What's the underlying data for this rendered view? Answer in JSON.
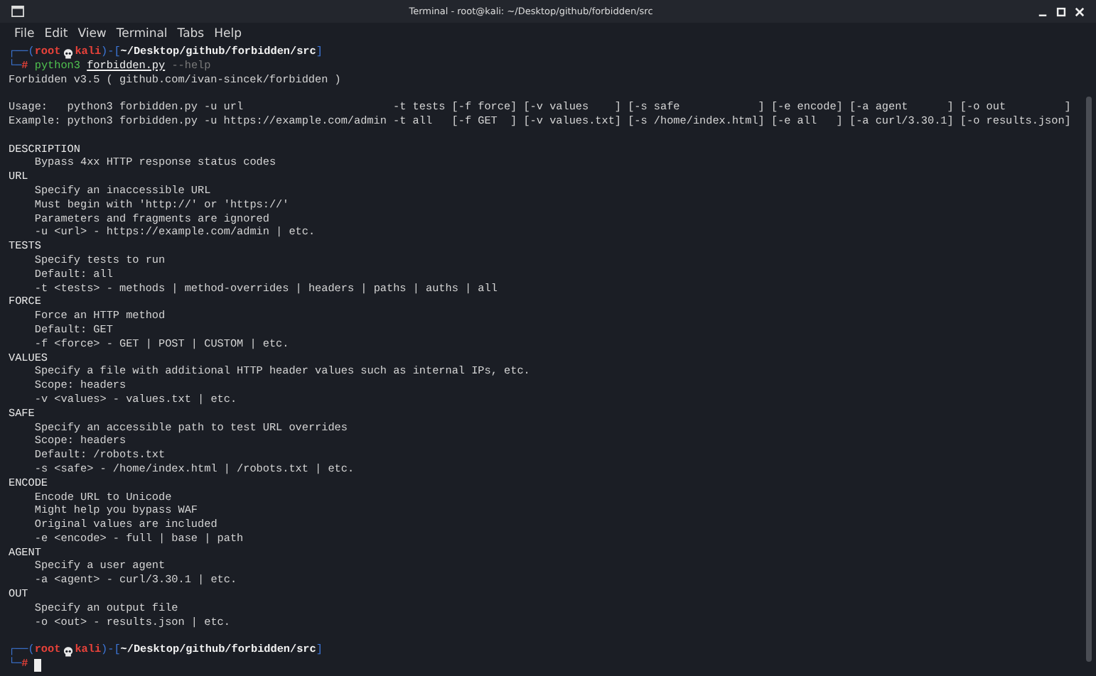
{
  "window": {
    "title": "Terminal - root@kali: ~/Desktop/github/forbidden/src"
  },
  "menu": [
    "File",
    "Edit",
    "View",
    "Terminal",
    "Tabs",
    "Help"
  ],
  "header": [
    {
      "kind": "prompt",
      "open": "┌──(",
      "user": "root",
      "host": "kali",
      "mid": ")-[",
      "path": "~/Desktop/github/forbidden/src",
      "close": "]"
    },
    {
      "kind": "command",
      "lead": "└─",
      "sign": "#",
      "program": "python3",
      "script": "forbidden.py",
      "args": "--help"
    },
    {
      "kind": "output",
      "text": "Forbidden v3.5 ( github.com/ivan-sincek/forbidden )"
    },
    {
      "kind": "output",
      "blank_before": true,
      "text": "Usage:   python3 forbidden.py -u url                       -t tests [-f force] [-v values    ] [-s safe            ] [-e encode] [-a agent      ] [-o out         ]"
    },
    {
      "kind": "output",
      "text": "Example: python3 forbidden.py -u https://example.com/admin -t all   [-f GET  ] [-v values.txt] [-s /home/index.html] [-e all   ] [-a curl/3.30.1] [-o results.json]"
    }
  ],
  "sections": [
    {
      "heading": "DESCRIPTION",
      "blank_before": true,
      "lines": [
        "Bypass 4xx HTTP response status codes"
      ]
    },
    {
      "heading": "URL",
      "lines": [
        "Specify an inaccessible URL",
        "Must begin with 'http://' or 'https://'",
        "Parameters and fragments are ignored",
        "-u <url> - https://example.com/admin | etc."
      ]
    },
    {
      "heading": "TESTS",
      "lines": [
        "Specify tests to run",
        "Default: all",
        "-t <tests> - methods | method-overrides | headers | paths | auths | all"
      ]
    },
    {
      "heading": "FORCE",
      "lines": [
        "Force an HTTP method",
        "Default: GET",
        "-f <force> - GET | POST | CUSTOM | etc."
      ]
    },
    {
      "heading": "VALUES",
      "lines": [
        "Specify a file with additional HTTP header values such as internal IPs, etc.",
        "Scope: headers",
        "-v <values> - values.txt | etc."
      ]
    },
    {
      "heading": "SAFE",
      "lines": [
        "Specify an accessible path to test URL overrides",
        "Scope: headers",
        "Default: /robots.txt",
        "-s <safe> - /home/index.html | /robots.txt | etc."
      ]
    },
    {
      "heading": "ENCODE",
      "lines": [
        "Encode URL to Unicode",
        "Might help you bypass WAF",
        "Original values are included",
        "-e <encode> - full | base | path"
      ]
    },
    {
      "heading": "AGENT",
      "lines": [
        "Specify a user agent",
        "-a <agent> - curl/3.30.1 | etc."
      ]
    },
    {
      "heading": "OUT",
      "lines": [
        "Specify an output file",
        "-o <out> - results.json | etc."
      ]
    }
  ],
  "footer": [
    {
      "kind": "prompt",
      "blank_before": true,
      "open": "┌──(",
      "user": "root",
      "host": "kali",
      "mid": ")-[",
      "path": "~/Desktop/github/forbidden/src",
      "close": "]"
    },
    {
      "kind": "input",
      "lead": "└─",
      "sign": "#"
    }
  ]
}
